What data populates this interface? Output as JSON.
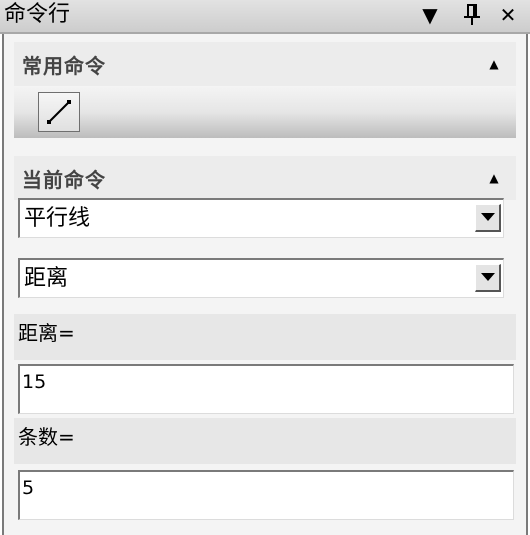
{
  "window": {
    "title": "命令行",
    "dropdown_glyph": "▼",
    "pin_glyph": "ᵜ",
    "close_glyph": "✕"
  },
  "common_commands": {
    "title": "常用命令",
    "collapse_glyph": "▲",
    "tools": [
      {
        "icon": "line-tool-icon"
      }
    ]
  },
  "current_command": {
    "title": "当前命令",
    "collapse_glyph": "▲",
    "command_select": {
      "value": "平行线"
    },
    "mode_select": {
      "value": "距离"
    },
    "params": [
      {
        "label": "距离=",
        "value": "15"
      },
      {
        "label": "条数=",
        "value": "5"
      }
    ]
  },
  "colors": {
    "titlebar": "#d4d4d4",
    "panel": "#f4f4f4",
    "section_header": "#ececec",
    "label_band": "#e7e7e7"
  }
}
